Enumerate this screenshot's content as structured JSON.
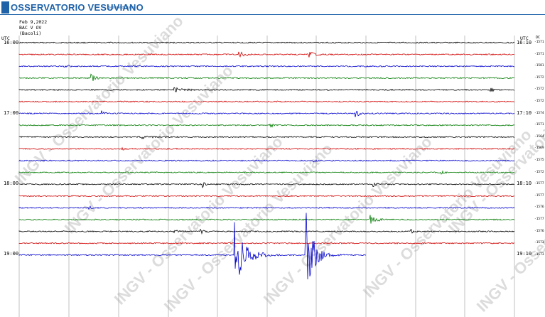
{
  "header": {
    "title": "OSSERVATORIO VESUVIANO",
    "subtitle": "Sezione di Napoli"
  },
  "meta": {
    "date": "Feb 9,2022",
    "station": "BAC V OV",
    "location": "(Bacoli)"
  },
  "axis": {
    "left_unit": "UTC",
    "right_unit": "UTC",
    "dc_label": "DC"
  },
  "left_time_labels": [
    "16:00",
    "17:00",
    "18:00",
    "19:00"
  ],
  "right_time_labels": [
    "16:10",
    "17:10",
    "18:10",
    "19:10"
  ],
  "dc_values": [
    "-1571",
    "-1571",
    "-1581",
    "-1572",
    "-1572",
    "-1572",
    "-1574",
    "-1571",
    "-1564",
    "-1569",
    "-1575",
    "-1572",
    "-1577",
    "-1577",
    "-1576",
    "-1577",
    "-1576",
    "-1573",
    "-1573"
  ],
  "watermark": "INGV - Osservatorio Vesuviano",
  "colors": {
    "brand": "#1f62a8",
    "trace_cycle": [
      "#000000",
      "#d00000",
      "#0000cc",
      "#007a00"
    ],
    "watermark": "#dcdcdc"
  },
  "chart_data": {
    "type": "line",
    "traces": 19,
    "trace_interval_minutes": 10,
    "minutes_per_line": 10,
    "events": [
      {
        "line": 18,
        "type": "earthquake",
        "description": "large amplitude burst"
      },
      {
        "line": 18,
        "type": "earthquake",
        "description": "large amplitude burst"
      }
    ]
  }
}
